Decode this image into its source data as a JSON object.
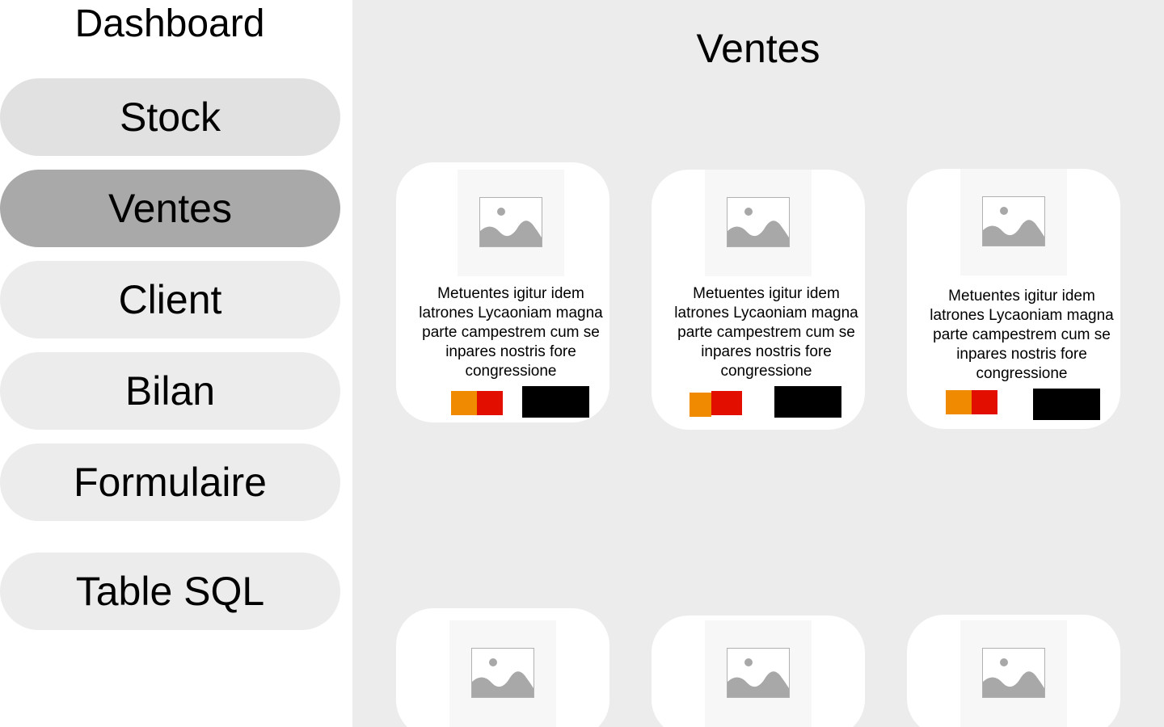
{
  "sidebar": {
    "title": "Dashboard",
    "items": [
      {
        "label": "Stock"
      },
      {
        "label": "Ventes",
        "active": true
      },
      {
        "label": "Client"
      },
      {
        "label": "Bilan"
      },
      {
        "label": "Formulaire"
      },
      {
        "label": "Table SQL"
      }
    ]
  },
  "main": {
    "title": "Ventes",
    "cards": [
      {
        "text": "Metuentes igitur idem latrones Lycaoniam magna parte campestrem cum se inpares nostris fore congressione",
        "icon": "image-placeholder-icon"
      },
      {
        "text": "Metuentes igitur idem latrones Lycaoniam magna parte campestrem cum se inpares nostris fore congressione",
        "icon": "image-placeholder-icon"
      },
      {
        "text": "Metuentes igitur idem latrones Lycaoniam magna parte campestrem cum se inpares nostris fore congressione",
        "icon": "image-placeholder-icon"
      },
      {
        "text": "",
        "icon": "image-placeholder-icon"
      },
      {
        "text": "",
        "icon": "image-placeholder-icon"
      },
      {
        "text": "",
        "icon": "image-placeholder-icon"
      }
    ]
  },
  "colors": {
    "sidebar_bg": "#ffffff",
    "main_bg": "#ececec",
    "nav_item_bg": "#ececec",
    "nav_item_active_bg": "#a9a9a9",
    "swatch_orange": "#f08a00",
    "swatch_red": "#e20f00",
    "action_button": "#000000"
  }
}
